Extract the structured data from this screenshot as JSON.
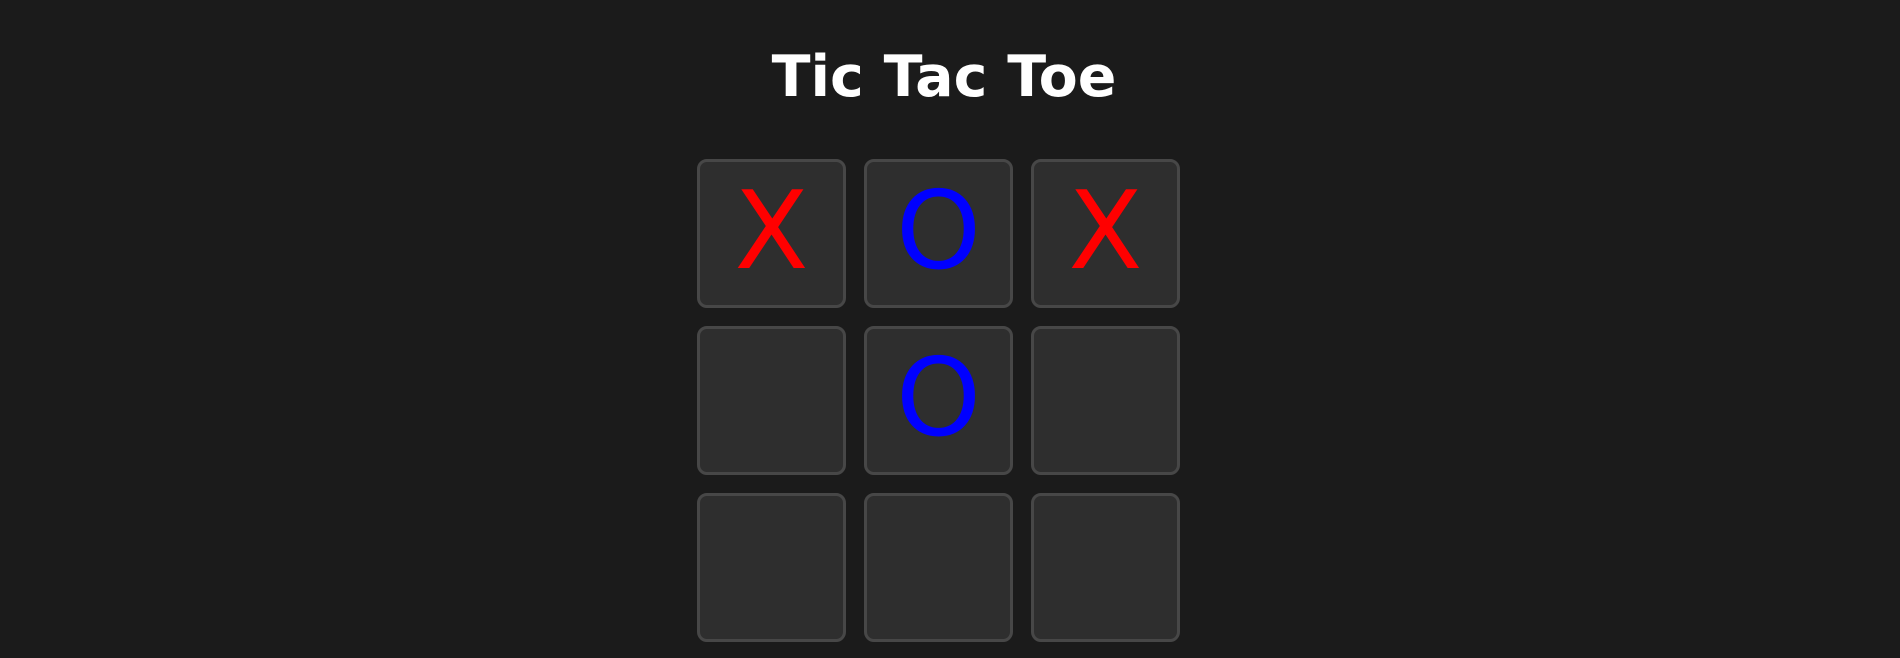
{
  "game": {
    "title": "Tic Tac Toe"
  },
  "colors": {
    "background": "#1b1b1b",
    "cell_background": "#2e2e2e",
    "cell_border": "#474747",
    "title": "#ffffff",
    "x": "#ff0000",
    "o": "#0000ff"
  },
  "board": {
    "cells": [
      "X",
      "O",
      "X",
      "",
      "O",
      "",
      "",
      "",
      ""
    ]
  }
}
